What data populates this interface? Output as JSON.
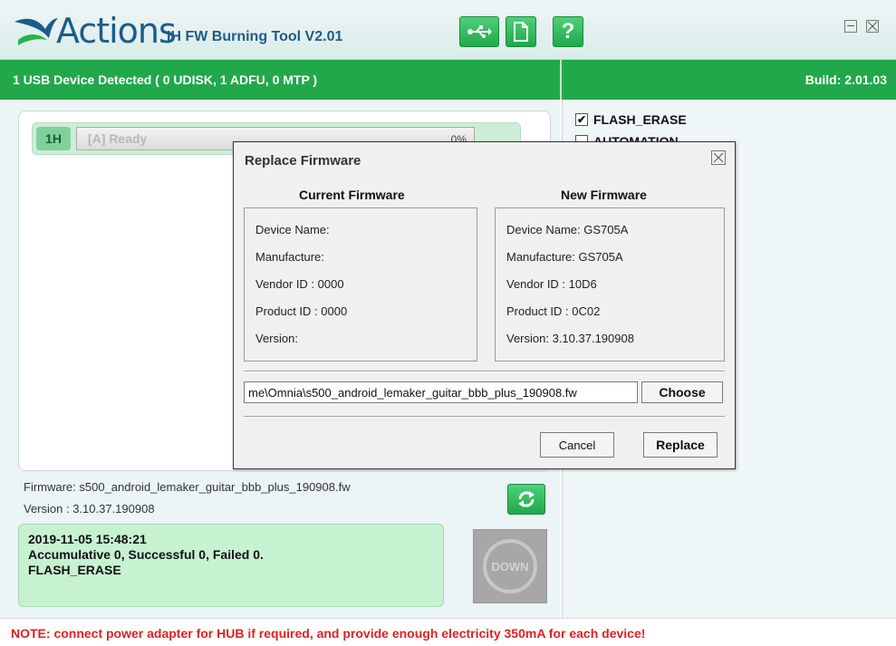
{
  "titlebar": {
    "brand": "Actions",
    "app_title": "IH FW Burning Tool V2.01",
    "help_label": "?"
  },
  "statusbar": {
    "usb_status": "1 USB Device Detected ( 0 UDISK, 1 ADFU, 0 MTP )",
    "build": "Build: 2.01.03"
  },
  "device_slot": {
    "id": "1H",
    "status": "[A] Ready",
    "percent": "0%",
    "progress": 0
  },
  "firmware_info": {
    "name": "Firmware: s500_android_lemaker_guitar_bbb_plus_190908.fw",
    "version": "Version : 3.10.37.190908"
  },
  "log": {
    "line1": "2019-11-05 15:48:21",
    "line2": "Accumulative 0, Successful 0, Failed 0.",
    "line3": "FLASH_ERASE"
  },
  "down_button": {
    "label": "DOWN"
  },
  "options": {
    "flash_erase": {
      "label": "FLASH_ERASE",
      "checked": true
    },
    "automation": {
      "label": "AUTOMATION",
      "checked": false
    }
  },
  "note": "NOTE: connect power adapter for HUB if required, and provide enough electricity 350mA for each device!",
  "dialog": {
    "title": "Replace Firmware",
    "current": {
      "heading": "Current Firmware",
      "device_name": "Device Name:",
      "manufacture": "Manufacture:",
      "vendor_id": "Vendor ID  : 0000",
      "product_id": "Product ID : 0000",
      "version": "Version:"
    },
    "new": {
      "heading": "New Firmware",
      "device_name": "Device Name: GS705A",
      "manufacture": "Manufacture: GS705A",
      "vendor_id": "Vendor ID  : 10D6",
      "product_id": "Product ID : 0C02",
      "version": "Version: 3.10.37.190908"
    },
    "path_value": "me\\Omnia\\s500_android_lemaker_guitar_bbb_plus_190908.fw",
    "choose_label": "Choose",
    "cancel_label": "Cancel",
    "replace_label": "Replace"
  },
  "colors": {
    "accent_green": "#21a84b",
    "brand_blue": "#1c5b8c",
    "note_red": "#e02020",
    "log_bg": "#c7f2d2"
  },
  "icons": [
    "actions-logo-icon",
    "usb-icon",
    "file-icon",
    "help-icon",
    "minimize-icon",
    "close-icon",
    "refresh-icon",
    "download-icon",
    "checkbox-checked-icon",
    "checkbox-empty-icon"
  ]
}
